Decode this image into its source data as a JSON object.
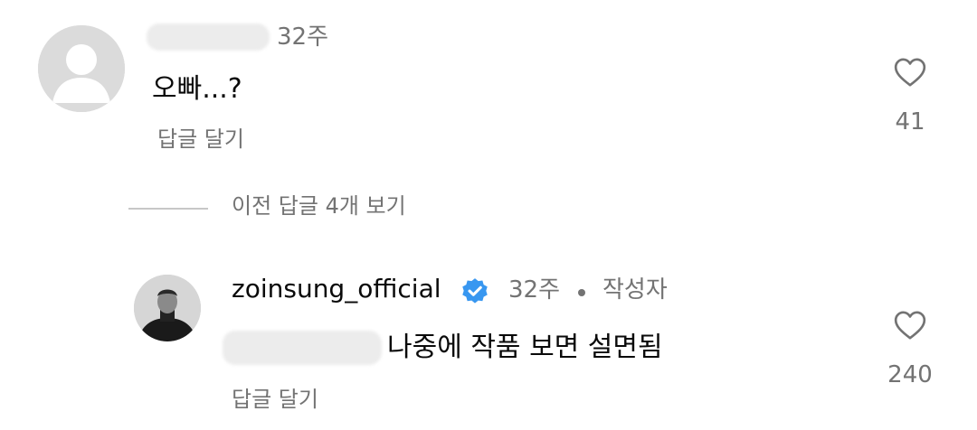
{
  "comments": [
    {
      "username_hidden": true,
      "time": "32주",
      "text": "오빠...?",
      "reply_label": "답글 달기",
      "likes": "41"
    },
    {
      "username": "zoinsung_official",
      "verified": true,
      "time": "32주",
      "author_badge": "작성자",
      "text": "나중에 작품 보면 설면됨",
      "reply_label": "답글 달기",
      "likes": "240"
    }
  ],
  "view_previous_replies": "이전 답글 4개 보기",
  "colors": {
    "text_primary": "#0a0a0a",
    "text_secondary": "#737373",
    "verified_blue": "#3897f0",
    "divider": "#c7c7c7"
  },
  "icons": [
    "default-avatar-icon",
    "heart-icon",
    "verified-badge-icon"
  ]
}
